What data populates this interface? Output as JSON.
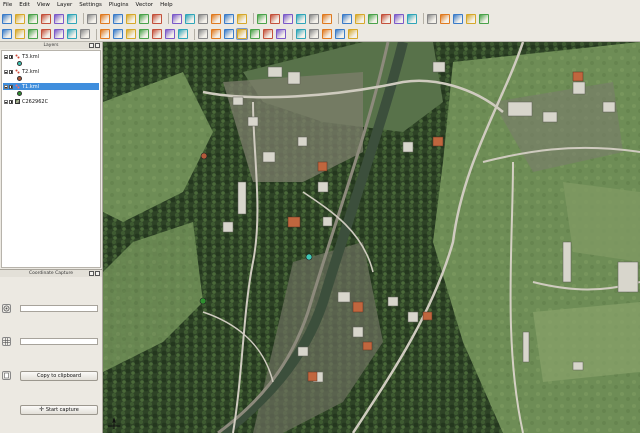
{
  "menubar": {
    "items": [
      "File",
      "Edit",
      "View",
      "Layer",
      "Settings",
      "Plugins",
      "Vector",
      "Help"
    ]
  },
  "toolbar": {
    "top_row_icons": [
      "new-project-icon",
      "open-project-icon",
      "save-project-icon",
      "save-as-icon",
      "print-composer-icon",
      "composer-manager-icon",
      "add-vector-layer-icon",
      "add-raster-layer-icon",
      "add-postgis-layer-icon",
      "add-spatialite-layer-icon",
      "add-wms-layer-icon",
      "add-wfs-layer-icon",
      "add-mssql-layer-icon",
      "new-shapefile-icon",
      "toggle-editing-icon",
      "save-edits-icon",
      "add-feature-icon",
      "move-feature-icon",
      "delete-selected-icon",
      "cut-features-icon",
      "copy-features-icon",
      "paste-features-icon",
      "identify-features-icon",
      "select-features-icon",
      "attribute-table-icon",
      "measure-line-icon",
      "map-tips-icon",
      "new-bookmark-icon",
      "show-bookmarks-icon",
      "text-annotation-icon",
      "globe-icon",
      "north-arrow-icon",
      "scale-bar-icon",
      "copyright-label-icon",
      "gps-icon"
    ],
    "bottom_row_icons": [
      "digitize-line-icon",
      "node-tool-icon",
      "move-feature-tool-icon",
      "rotate-feature-icon",
      "simplify-feature-icon",
      "add-ring-icon",
      "add-part-icon",
      "delete-ring-icon",
      "delete-part-icon",
      "reshape-features-icon",
      "offset-curve-icon",
      "split-features-icon",
      "merge-features-icon",
      "undo-icon",
      "redo-icon",
      "label-icon",
      "pan-map-icon",
      "pan-to-selection-icon",
      "zoom-in-icon",
      "zoom-out-icon",
      "zoom-full-icon",
      "zoom-to-layer-icon",
      "zoom-to-selection-icon",
      "zoom-last-icon",
      "zoom-next-icon",
      "refresh-icon"
    ],
    "active_tool": "pan-to-selection-icon"
  },
  "layers_panel": {
    "title": "Layers",
    "layers": [
      {
        "name": "T3.kml",
        "selected": false,
        "symbol_color": "#3fc7b6"
      },
      {
        "name": "T2.kml",
        "selected": false,
        "symbol_color": "#b35a3a"
      },
      {
        "name": "T1.kml",
        "selected": true,
        "symbol_color": "#2f8f2f"
      },
      {
        "name": "C262962C",
        "selected": false,
        "symbol_color": ""
      }
    ]
  },
  "coordinate_capture": {
    "title": "Coordinate Capture",
    "field1_value": "",
    "field2_value": "",
    "copy_button_label": "Copy to clipboard",
    "start_button_label": "Start capture"
  },
  "map": {
    "layer": "C262962C",
    "points": [
      {
        "name": "T2 point",
        "color": "#b35a3a"
      },
      {
        "name": "T3 point",
        "color": "#3fc7b6"
      },
      {
        "name": "T1 point",
        "color": "#2f8f2f"
      }
    ]
  },
  "colors": {
    "chrome": "#ece9e2",
    "selection": "#3f8edd",
    "forest": "#2c3f22",
    "meadow": "#6f8f55",
    "road": "#cfcbbf"
  }
}
